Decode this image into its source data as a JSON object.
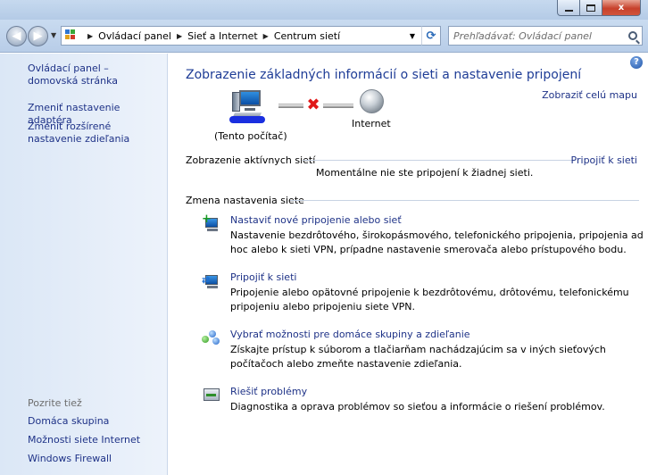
{
  "window": {
    "controls": {
      "minimize": "",
      "maximize": "",
      "close": "x"
    }
  },
  "navigation": {
    "breadcrumbs": [
      "Ovládací panel",
      "Sieť a Internet",
      "Centrum sietí"
    ],
    "search_placeholder": "Prehľadávať: Ovládací panel"
  },
  "sidebar": {
    "top_links": [
      "Ovládací panel – domovská stránka",
      "Zmeniť nastavenie adaptéra",
      "Zmeniť rozšírené nastavenie zdieľania"
    ],
    "see_also_heading": "Pozrite tiež",
    "see_also_links": [
      "Domáca skupina",
      "Možnosti siete Internet",
      "Windows Firewall"
    ]
  },
  "main": {
    "help": "?",
    "title": "Zobrazenie základných informácií o sieti a nastavenie pripojení",
    "view_full_map": "Zobraziť celú mapu",
    "diagram": {
      "computer_label": "(Tento počítač)",
      "internet_label": "Internet",
      "status_mark": "✖"
    },
    "active_networks": {
      "heading": "Zobrazenie aktívnych sietí",
      "connect_link": "Pripojiť k sieti",
      "status": "Momentálne nie ste pripojení k žiadnej sieti."
    },
    "change_settings": {
      "heading": "Zmena nastavenia siete",
      "tasks": [
        {
          "icon": "network-setup-icon",
          "title": "Nastaviť nové pripojenie alebo sieť",
          "description": "Nastavenie bezdrôtového, širokopásmového, telefonického pripojenia, pripojenia ad hoc alebo k sieti VPN, prípadne nastavenie smerovača alebo prístupového bodu."
        },
        {
          "icon": "connect-network-icon",
          "title": "Pripojiť k sieti",
          "description": "Pripojenie alebo opätovné pripojenie k bezdrôtovému, drôtovému, telefonickému pripojeniu alebo pripojeniu siete VPN."
        },
        {
          "icon": "homegroup-icon",
          "title": "Vybrať možnosti pre domáce skupiny a zdieľanie",
          "description": "Získajte prístup k súborom a tlačiarňam nachádzajúcim sa v iných sieťových počítačoch alebo zmeňte nastavenie zdieľania."
        },
        {
          "icon": "troubleshoot-icon",
          "title": "Riešiť problémy",
          "description": "Diagnostika a oprava problémov so sieťou a informácie o riešení problémov."
        }
      ]
    }
  }
}
